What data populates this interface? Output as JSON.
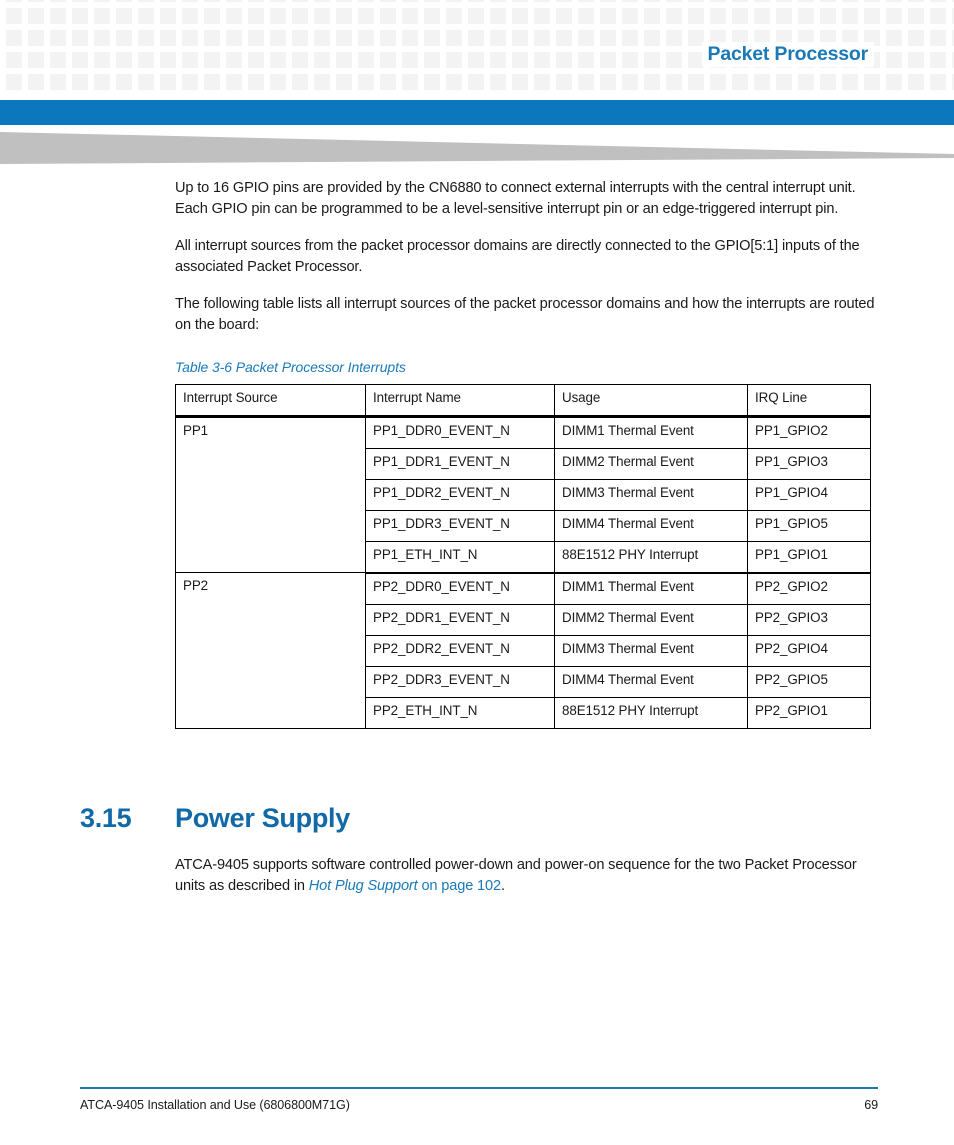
{
  "header": {
    "title": "Packet Processor",
    "accent_blue": "#0b78bd",
    "grid_square_color": "#f3f3f3",
    "wedge_color": "#c0c0c0"
  },
  "main": {
    "paragraphs": [
      "Up to 16 GPIO pins are provided by the CN6880 to connect external interrupts with the central interrupt unit. Each GPIO pin can be programmed to be a level-sensitive interrupt pin or an edge-triggered interrupt pin.",
      "All interrupt sources from the packet processor domains are directly connected to the GPIO[5:1] inputs of the associated Packet Processor.",
      "The following table lists all interrupt sources of the packet processor domains and how the interrupts are routed on the board:"
    ],
    "table_caption": "Table 3-6 Packet Processor Interrupts",
    "table": {
      "columns": [
        "Interrupt Source",
        "Interrupt Name",
        "Usage",
        "IRQ Line"
      ],
      "groups": [
        {
          "source": "PP1",
          "rows": [
            {
              "name": "PP1_DDR0_EVENT_N",
              "usage": "DIMM1 Thermal Event",
              "irq": "PP1_GPIO2"
            },
            {
              "name": "PP1_DDR1_EVENT_N",
              "usage": "DIMM2 Thermal Event",
              "irq": "PP1_GPIO3"
            },
            {
              "name": "PP1_DDR2_EVENT_N",
              "usage": "DIMM3 Thermal Event",
              "irq": "PP1_GPIO4"
            },
            {
              "name": "PP1_DDR3_EVENT_N",
              "usage": "DIMM4 Thermal Event",
              "irq": "PP1_GPIO5"
            },
            {
              "name": "PP1_ETH_INT_N",
              "usage": "88E1512 PHY Interrupt",
              "irq": "PP1_GPIO1"
            }
          ]
        },
        {
          "source": "PP2",
          "rows": [
            {
              "name": "PP2_DDR0_EVENT_N",
              "usage": "DIMM1 Thermal Event",
              "irq": "PP2_GPIO2"
            },
            {
              "name": "PP2_DDR1_EVENT_N",
              "usage": "DIMM2 Thermal Event",
              "irq": "PP2_GPIO3"
            },
            {
              "name": "PP2_DDR2_EVENT_N",
              "usage": "DIMM3 Thermal Event",
              "irq": "PP2_GPIO4"
            },
            {
              "name": "PP2_DDR3_EVENT_N",
              "usage": "DIMM4 Thermal Event",
              "irq": "PP2_GPIO5"
            },
            {
              "name": "PP2_ETH_INT_N",
              "usage": "88E1512 PHY Interrupt",
              "irq": "PP2_GPIO1"
            }
          ]
        }
      ]
    }
  },
  "section": {
    "number": "3.15",
    "title": "Power Supply",
    "body_lead": "ATCA-9405 supports software controlled power-down and power-on sequence for the two Packet Processor units as described in ",
    "xref_title": "Hot Plug Support",
    "xref_page": " on page 102",
    "body_tail": "."
  },
  "footer": {
    "document": "ATCA-9405 Installation and Use (6806800M71G)",
    "page_number": "69",
    "rule_color": "#1a7ab8"
  }
}
